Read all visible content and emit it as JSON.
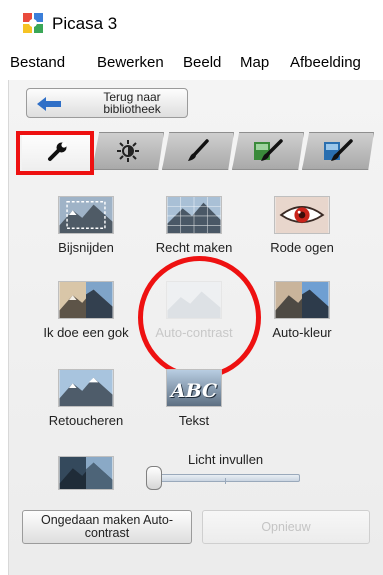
{
  "window": {
    "title": "Picasa 3"
  },
  "menu": [
    "Bestand",
    "Bewerken",
    "Beeld",
    "Map",
    "Afbeelding"
  ],
  "back_button": {
    "line1": "Terug naar",
    "line2": "bibliotheek"
  },
  "tabs": [
    {
      "icon": "wrench-icon",
      "active": true
    },
    {
      "icon": "sun-icon",
      "active": false
    },
    {
      "icon": "brush-icon",
      "active": false
    },
    {
      "icon": "green-brush-icon",
      "active": false
    },
    {
      "icon": "blue-brush-icon",
      "active": false
    }
  ],
  "tools": {
    "crop": "Bijsnijden",
    "straighten": "Recht maken",
    "redeye": "Rode ogen",
    "feeling_lucky": "Ik doe een gok",
    "auto_contrast": "Auto-contrast",
    "auto_color": "Auto-kleur",
    "retouch": "Retoucheren",
    "text": "Tekst",
    "text_thumb": "ABC"
  },
  "fill_light": {
    "label": "Licht invullen",
    "value": 0
  },
  "buttons": {
    "undo_line1": "Ongedaan maken Auto-",
    "undo_line2": "contrast",
    "redo": "Opnieuw"
  },
  "colors": {
    "highlight": "#ee1111",
    "accent_blue": "#1f5fa8"
  }
}
